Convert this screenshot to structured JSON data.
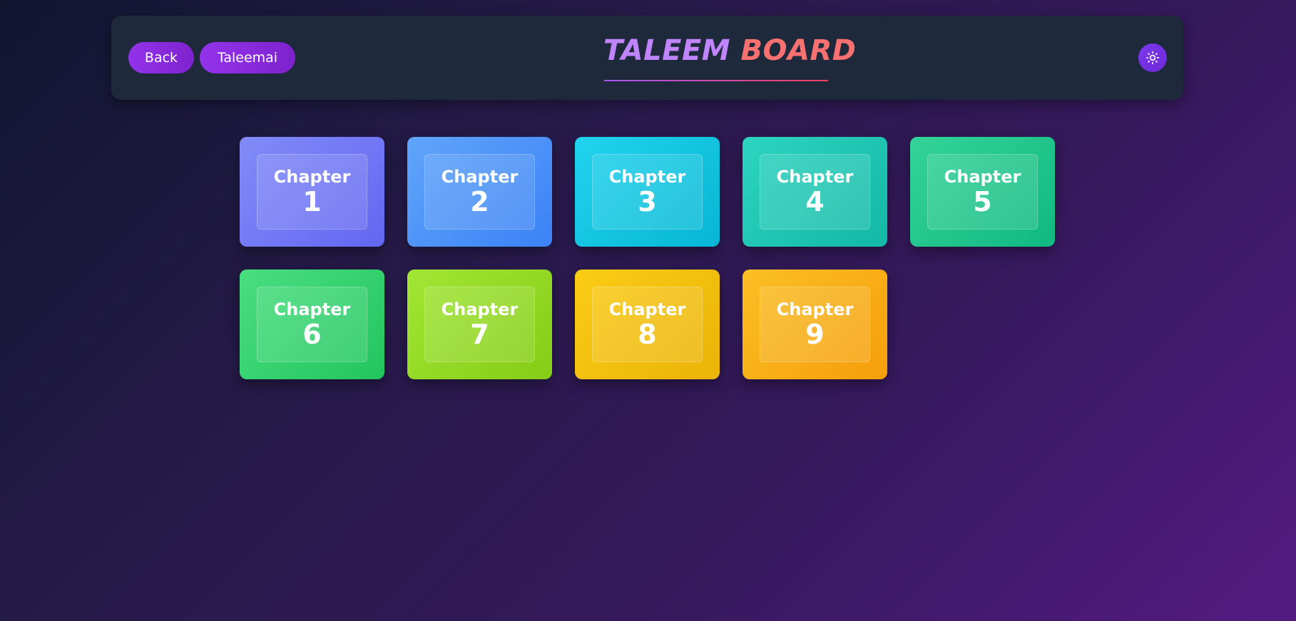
{
  "header": {
    "back_label": "Back",
    "taleemai_label": "Taleemai",
    "title_part1": "TALEEM",
    "title_part2": "BOARD",
    "theme_toggle_icon": "sun-icon"
  },
  "chapters": [
    {
      "label": "Chapter",
      "number": "1",
      "color_from": "#818cf8",
      "color_to": "#6366f1"
    },
    {
      "label": "Chapter",
      "number": "2",
      "color_from": "#60a5fa",
      "color_to": "#3b82f6"
    },
    {
      "label": "Chapter",
      "number": "3",
      "color_from": "#22d3ee",
      "color_to": "#06b6d4"
    },
    {
      "label": "Chapter",
      "number": "4",
      "color_from": "#2dd4bf",
      "color_to": "#14b8a6"
    },
    {
      "label": "Chapter",
      "number": "5",
      "color_from": "#34d399",
      "color_to": "#10b981"
    },
    {
      "label": "Chapter",
      "number": "6",
      "color_from": "#4ade80",
      "color_to": "#22c55e"
    },
    {
      "label": "Chapter",
      "number": "7",
      "color_from": "#a3e635",
      "color_to": "#84cc16"
    },
    {
      "label": "Chapter",
      "number": "8",
      "color_from": "#facc15",
      "color_to": "#eab308"
    },
    {
      "label": "Chapter",
      "number": "9",
      "color_from": "#fbbf24",
      "color_to": "#f59e0b"
    }
  ]
}
